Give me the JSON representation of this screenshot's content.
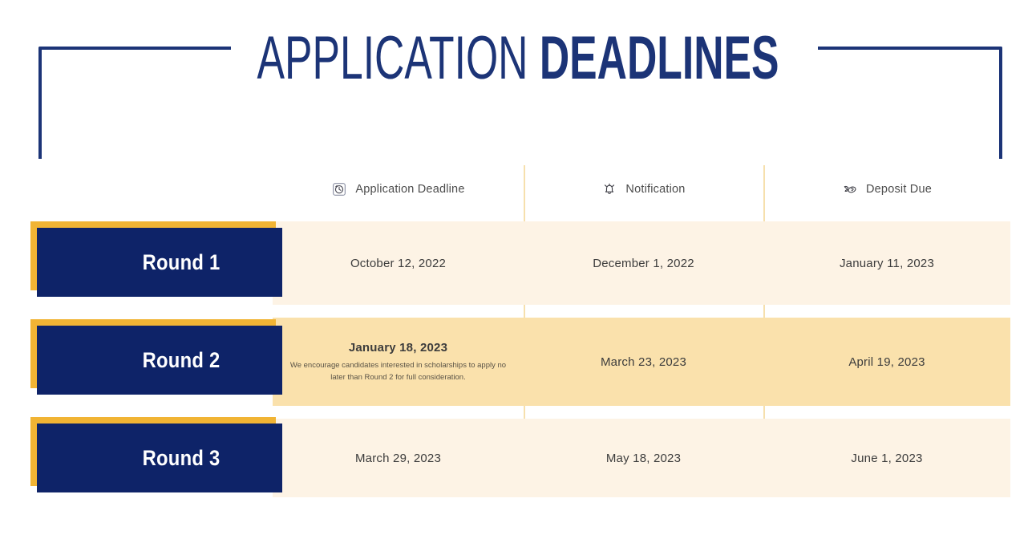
{
  "header": {
    "title_light": "APPLICATION",
    "title_bold": "DEADLINES",
    "bracket_color": "#1c3477"
  },
  "theme": {
    "navy": "#0e2368",
    "gold": "#f1b434",
    "cream": "#fdf3e5",
    "tan": "#fae1ac",
    "divider": "#f6e0ad",
    "title_blue": "#1c3477"
  },
  "table": {
    "columns": [
      {
        "icon": "alarm-clock-icon",
        "label": "Application Deadline"
      },
      {
        "icon": "notification-bell-icon",
        "label": "Notification"
      },
      {
        "icon": "money-with-wings-icon",
        "label": "Deposit Due"
      }
    ],
    "rows": [
      {
        "round": "Round 1",
        "application_deadline": "October 12, 2022",
        "application_note": "",
        "notification": "December 1, 2022",
        "deposit_due": "January 11, 2023"
      },
      {
        "round": "Round 2",
        "application_deadline": "January 18, 2023",
        "application_note": "We encourage candidates interested in scholarships to apply no later than Round 2 for full consideration.",
        "notification": "March 23, 2023",
        "deposit_due": "April 19, 2023"
      },
      {
        "round": "Round 3",
        "application_deadline": "March 29, 2023",
        "application_note": "",
        "notification": "May 18, 2023",
        "deposit_due": "June 1, 2023"
      }
    ]
  }
}
